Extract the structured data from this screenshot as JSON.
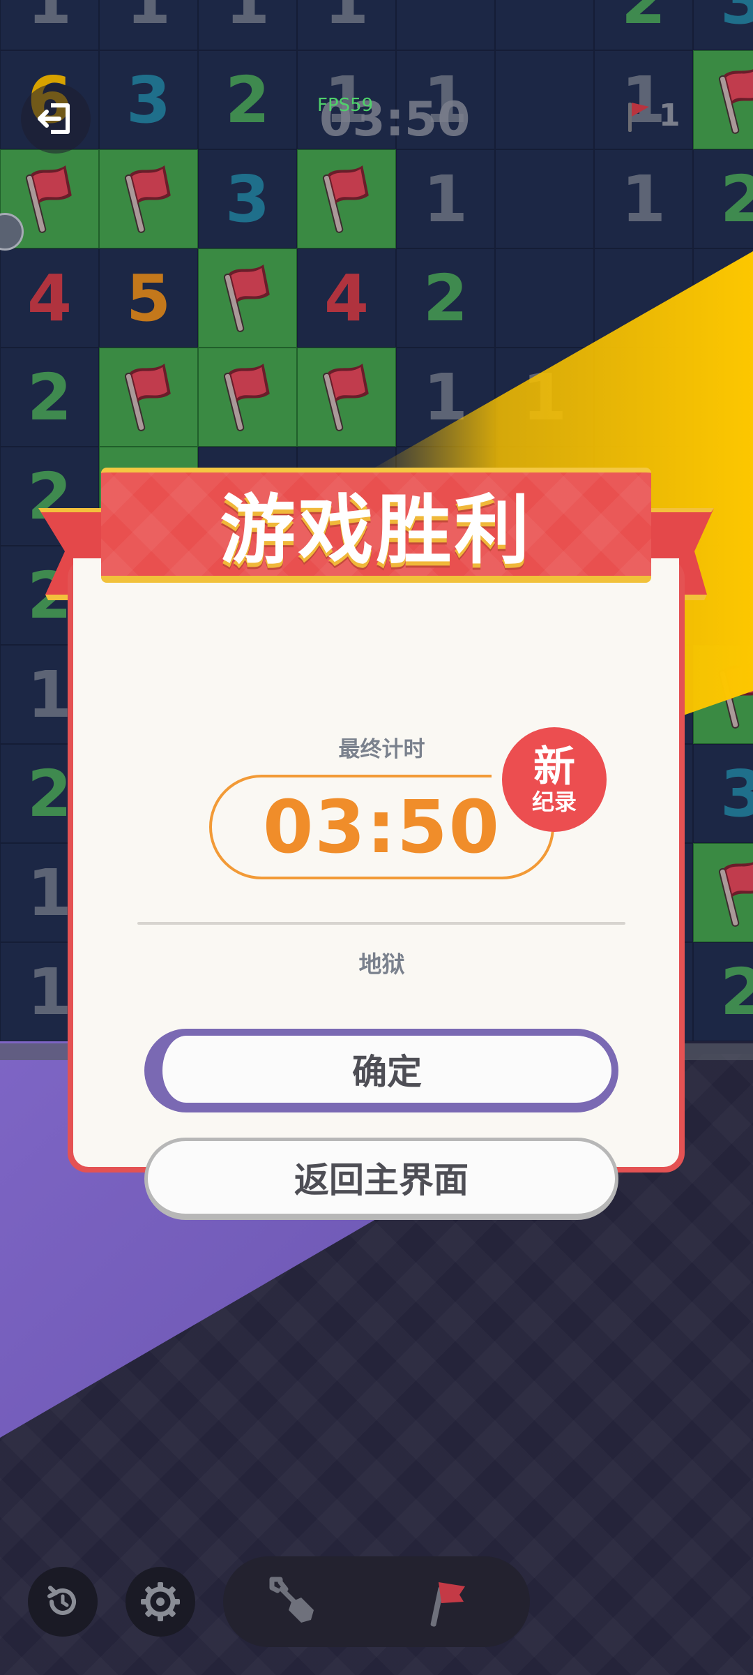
{
  "board": {
    "cells": [
      {
        "v": "1",
        "k": "c1"
      },
      {
        "v": "1",
        "k": "c1"
      },
      {
        "v": "1",
        "k": "c1"
      },
      {
        "v": "1",
        "k": "c1"
      },
      {
        "v": "",
        "k": ""
      },
      {
        "v": "",
        "k": ""
      },
      {
        "v": "2",
        "k": "c2"
      },
      {
        "v": "3",
        "k": "c3"
      },
      {
        "v": "6",
        "k": "c6"
      },
      {
        "v": "3",
        "k": "c3"
      },
      {
        "v": "2",
        "k": "c2"
      },
      {
        "v": "1",
        "k": "c1"
      },
      {
        "v": "1",
        "k": "c1"
      },
      {
        "v": "",
        "k": ""
      },
      {
        "v": "1",
        "k": "c1"
      },
      {
        "v": "F",
        "k": "flagged"
      },
      {
        "v": "F",
        "k": "flagged"
      },
      {
        "v": "F",
        "k": "flagged"
      },
      {
        "v": "3",
        "k": "c3"
      },
      {
        "v": "F",
        "k": "flagged"
      },
      {
        "v": "1",
        "k": "c1"
      },
      {
        "v": "",
        "k": ""
      },
      {
        "v": "1",
        "k": "c1"
      },
      {
        "v": "2",
        "k": "c2"
      },
      {
        "v": "4",
        "k": "c4"
      },
      {
        "v": "5",
        "k": "c5"
      },
      {
        "v": "F",
        "k": "flagged"
      },
      {
        "v": "4",
        "k": "c4"
      },
      {
        "v": "2",
        "k": "c2"
      },
      {
        "v": "",
        "k": ""
      },
      {
        "v": "",
        "k": ""
      },
      {
        "v": "",
        "k": ""
      },
      {
        "v": "2",
        "k": "c2"
      },
      {
        "v": "F",
        "k": "flagged"
      },
      {
        "v": "F",
        "k": "flagged"
      },
      {
        "v": "F",
        "k": "flagged"
      },
      {
        "v": "1",
        "k": "c1"
      },
      {
        "v": "1",
        "k": "c1"
      },
      {
        "v": "",
        "k": ""
      },
      {
        "v": "",
        "k": ""
      },
      {
        "v": "2",
        "k": "c2"
      },
      {
        "v": "",
        "k": "flagged"
      },
      {
        "v": "",
        "k": ""
      },
      {
        "v": "",
        "k": ""
      },
      {
        "v": "",
        "k": ""
      },
      {
        "v": "",
        "k": ""
      },
      {
        "v": "",
        "k": ""
      },
      {
        "v": "",
        "k": ""
      },
      {
        "v": "2",
        "k": "c2"
      },
      {
        "v": "",
        "k": ""
      },
      {
        "v": "",
        "k": ""
      },
      {
        "v": "",
        "k": ""
      },
      {
        "v": "",
        "k": ""
      },
      {
        "v": "",
        "k": ""
      },
      {
        "v": "",
        "k": ""
      },
      {
        "v": "",
        "k": ""
      },
      {
        "v": "1",
        "k": "c1"
      },
      {
        "v": "",
        "k": ""
      },
      {
        "v": "",
        "k": ""
      },
      {
        "v": "",
        "k": ""
      },
      {
        "v": "",
        "k": ""
      },
      {
        "v": "",
        "k": ""
      },
      {
        "v": "",
        "k": ""
      },
      {
        "v": "F",
        "k": "flagged"
      },
      {
        "v": "2",
        "k": "c2"
      },
      {
        "v": "",
        "k": ""
      },
      {
        "v": "",
        "k": ""
      },
      {
        "v": "",
        "k": ""
      },
      {
        "v": "",
        "k": ""
      },
      {
        "v": "",
        "k": ""
      },
      {
        "v": "",
        "k": ""
      },
      {
        "v": "3",
        "k": "c3"
      },
      {
        "v": "1",
        "k": "c1"
      },
      {
        "v": "",
        "k": ""
      },
      {
        "v": "",
        "k": ""
      },
      {
        "v": "",
        "k": ""
      },
      {
        "v": "",
        "k": ""
      },
      {
        "v": "",
        "k": ""
      },
      {
        "v": "",
        "k": ""
      },
      {
        "v": "F",
        "k": "flagged"
      },
      {
        "v": "1",
        "k": "c1"
      },
      {
        "v": "",
        "k": ""
      },
      {
        "v": "",
        "k": ""
      },
      {
        "v": "",
        "k": ""
      },
      {
        "v": "",
        "k": ""
      },
      {
        "v": "",
        "k": ""
      },
      {
        "v": "",
        "k": ""
      },
      {
        "v": "2",
        "k": "c2"
      }
    ]
  },
  "hud": {
    "fps": "FPS59",
    "timer": "03:50",
    "flags_left": "1"
  },
  "dialog": {
    "title": "游戏胜利",
    "final_time_label": "最终计时",
    "final_time": "03:50",
    "new_record_big": "新",
    "new_record_small": "纪录",
    "difficulty": "地狱",
    "confirm_label": "确定",
    "back_label": "返回主界面"
  },
  "colors": {
    "ribbon": "#e9504f",
    "accent_orange": "#f08d2a",
    "confirm_border": "#7a69b3",
    "flag_cell": "#3a8a43"
  }
}
